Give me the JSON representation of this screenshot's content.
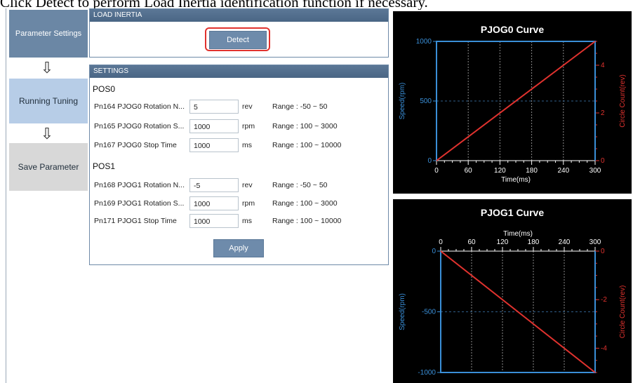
{
  "banner": "Click Detect to perform Load Inertia identification function if necessary.",
  "steps": {
    "parameter_settings": "Parameter Settings",
    "running_tuning": "Running Tuning",
    "save_parameter": "Save Parameter",
    "arrow": "⇩"
  },
  "load_inertia": {
    "title": "LOAD INERTIA",
    "detect_label": "Detect"
  },
  "settings": {
    "title": "SETTINGS",
    "pos0": {
      "title": "POS0",
      "rows": [
        {
          "label": "Pn164 PJOG0 Rotation N...",
          "value": "5",
          "unit": "rev",
          "range": "Range :  -50  ~  50"
        },
        {
          "label": "Pn165 PJOG0 Rotation S...",
          "value": "1000",
          "unit": "rpm",
          "range": "Range :  100  ~  3000"
        },
        {
          "label": "Pn167 PJOG0 Stop Time",
          "value": "1000",
          "unit": "ms",
          "range": "Range :  100  ~  10000"
        }
      ]
    },
    "pos1": {
      "title": "POS1",
      "rows": [
        {
          "label": "Pn168 PJOG1 Rotation N...",
          "value": "-5",
          "unit": "rev",
          "range": "Range :  -50  ~  50"
        },
        {
          "label": "Pn169 PJOG1 Rotation S...",
          "value": "1000",
          "unit": "rpm",
          "range": "Range :  100  ~  3000"
        },
        {
          "label": "Pn171 PJOG1 Stop Time",
          "value": "1000",
          "unit": "ms",
          "range": "Range :  100  ~  10000"
        }
      ]
    },
    "apply_label": "Apply"
  },
  "colors": {
    "speed": "#3a8fd8",
    "circle": "#e0322e",
    "accent_border": "#e0322e"
  },
  "chart_data": [
    {
      "type": "line",
      "title": "PJOG0 Curve",
      "xlabel": "Time(ms)",
      "ylabel_left": "Speed(rpm)",
      "ylabel_right": "Circle Count(rev)",
      "xlim": [
        0,
        300
      ],
      "ylim_left": [
        0,
        1000
      ],
      "ylim_right": [
        0,
        5
      ],
      "x_ticks": [
        "0",
        "60",
        "120",
        "180",
        "240",
        "300"
      ],
      "y_left_ticks": [
        "0",
        "500",
        "1000"
      ],
      "y_right_ticks": [
        "0",
        "2",
        "4"
      ],
      "x_axis_position": "bottom",
      "series": [
        {
          "axis": "left",
          "color": "#3a8fd8",
          "x": [
            0,
            0,
            300,
            300
          ],
          "y": [
            0,
            1000,
            1000,
            0
          ]
        },
        {
          "axis": "right",
          "color": "#e0322e",
          "x": [
            0,
            300
          ],
          "y": [
            0,
            5
          ]
        }
      ]
    },
    {
      "type": "line",
      "title": "PJOG1 Curve",
      "xlabel": "Time(ms)",
      "ylabel_left": "Speed(rpm)",
      "ylabel_right": "Circle Count(rev)",
      "xlim": [
        0,
        300
      ],
      "ylim_left": [
        -1000,
        0
      ],
      "ylim_right": [
        -5,
        0
      ],
      "x_ticks": [
        "0",
        "60",
        "120",
        "180",
        "240",
        "300"
      ],
      "y_left_ticks": [
        "0",
        "-500",
        "-1000"
      ],
      "y_right_ticks": [
        "0",
        "-2",
        "-4"
      ],
      "x_axis_position": "top",
      "series": [
        {
          "axis": "left",
          "color": "#3a8fd8",
          "x": [
            0,
            0,
            300,
            300
          ],
          "y": [
            0,
            -1000,
            -1000,
            0
          ]
        },
        {
          "axis": "right",
          "color": "#e0322e",
          "x": [
            0,
            300
          ],
          "y": [
            0,
            -5
          ]
        }
      ]
    }
  ]
}
